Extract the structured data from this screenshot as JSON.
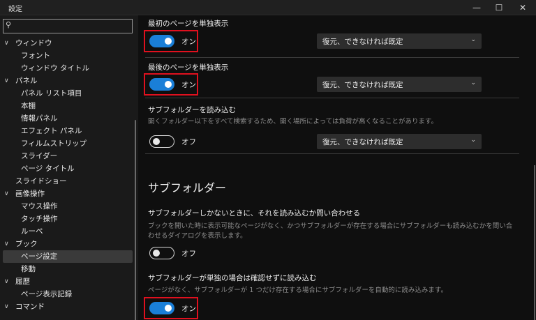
{
  "window": {
    "title": "設定",
    "minimize": "—",
    "maximize": "☐",
    "close": "✕"
  },
  "sidebar": {
    "search_icon": "search-icon",
    "items": [
      {
        "label": "ウィンドウ",
        "level": 0,
        "expanded": true
      },
      {
        "label": "フォント",
        "level": 1
      },
      {
        "label": "ウィンドウ タイトル",
        "level": 1
      },
      {
        "label": "パネル",
        "level": 0,
        "expanded": true
      },
      {
        "label": "パネル リスト項目",
        "level": 1
      },
      {
        "label": "本棚",
        "level": 1
      },
      {
        "label": "情報パネル",
        "level": 1
      },
      {
        "label": "エフェクト パネル",
        "level": 1
      },
      {
        "label": "フィルムストリップ",
        "level": 1
      },
      {
        "label": "スライダー",
        "level": 1
      },
      {
        "label": "ページ タイトル",
        "level": 1
      },
      {
        "label": "スライドショー",
        "level": 0,
        "expanded": false
      },
      {
        "label": "画像操作",
        "level": 0,
        "expanded": true
      },
      {
        "label": "マウス操作",
        "level": 1
      },
      {
        "label": "タッチ操作",
        "level": 1
      },
      {
        "label": "ルーペ",
        "level": 1
      },
      {
        "label": "ブック",
        "level": 0,
        "expanded": true
      },
      {
        "label": "ページ設定",
        "level": 1,
        "selected": true
      },
      {
        "label": "移動",
        "level": 1
      },
      {
        "label": "履歴",
        "level": 0,
        "expanded": true
      },
      {
        "label": "ページ表示記録",
        "level": 1
      },
      {
        "label": "コマンド",
        "level": 0,
        "expanded": true
      }
    ]
  },
  "content": {
    "first_page": {
      "title": "最初のページを単独表示",
      "toggle": "オン",
      "state": true,
      "select": "復元、できなければ既定"
    },
    "last_page": {
      "title": "最後のページを単独表示",
      "toggle": "オン",
      "state": true,
      "select": "復元、できなければ既定"
    },
    "load_subfolders": {
      "title": "サブフォルダーを読み込む",
      "desc": "開くフォルダー以下をすべて検索するため、開く場所によっては負荷が高くなることがあります。",
      "toggle": "オフ",
      "state": false,
      "select": "復元、できなければ既定"
    },
    "section_subfolder": "サブフォルダー",
    "ask_subfolder": {
      "title": "サブフォルダーしかないときに、それを読み込むか問い合わせる",
      "desc": "ブックを開いた時に表示可能なページがなく、かつサブフォルダーが存在する場合にサブフォルダーも読み込むかを問い合わせるダイアログを表示します。",
      "toggle": "オフ",
      "state": false
    },
    "single_subfolder": {
      "title": "サブフォルダーが単独の場合は確認せずに読み込む",
      "desc": "ページがなく、サブフォルダーが 1 つだけ存在する場合にサブフォルダーを自動的に読み込みます。",
      "toggle": "オン",
      "state": true
    },
    "select_arrow": "chevron-down-icon"
  },
  "colors": {
    "accent": "#1a7fd8",
    "highlight": "#e0101e"
  }
}
